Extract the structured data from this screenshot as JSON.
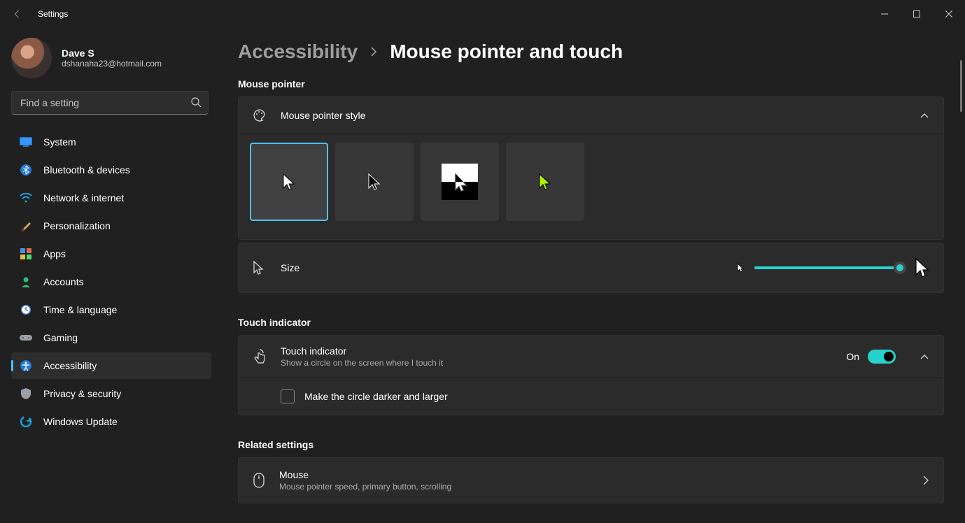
{
  "titlebar": {
    "title": "Settings"
  },
  "user": {
    "name": "Dave S",
    "email": "dshanaha23@hotmail.com"
  },
  "search": {
    "placeholder": "Find a setting"
  },
  "nav": {
    "items": [
      {
        "label": "System"
      },
      {
        "label": "Bluetooth & devices"
      },
      {
        "label": "Network & internet"
      },
      {
        "label": "Personalization"
      },
      {
        "label": "Apps"
      },
      {
        "label": "Accounts"
      },
      {
        "label": "Time & language"
      },
      {
        "label": "Gaming"
      },
      {
        "label": "Accessibility"
      },
      {
        "label": "Privacy & security"
      },
      {
        "label": "Windows Update"
      }
    ]
  },
  "breadcrumb": {
    "parent": "Accessibility",
    "current": "Mouse pointer and touch"
  },
  "sections": {
    "pointer_label": "Mouse pointer",
    "touch_label": "Touch indicator",
    "related_label": "Related settings"
  },
  "pointer_style_row": {
    "label": "Mouse pointer style"
  },
  "size_row": {
    "label": "Size"
  },
  "touch_row": {
    "title": "Touch indicator",
    "subtitle": "Show a circle on the screen where I touch it",
    "toggle_text": "On"
  },
  "touch_option": {
    "label": "Make the circle darker and larger"
  },
  "related_mouse": {
    "title": "Mouse",
    "subtitle": "Mouse pointer speed, primary button, scrolling"
  },
  "colors": {
    "accent": "#4cc2ff",
    "teal": "#29d1cc",
    "lime": "#aef20c"
  }
}
